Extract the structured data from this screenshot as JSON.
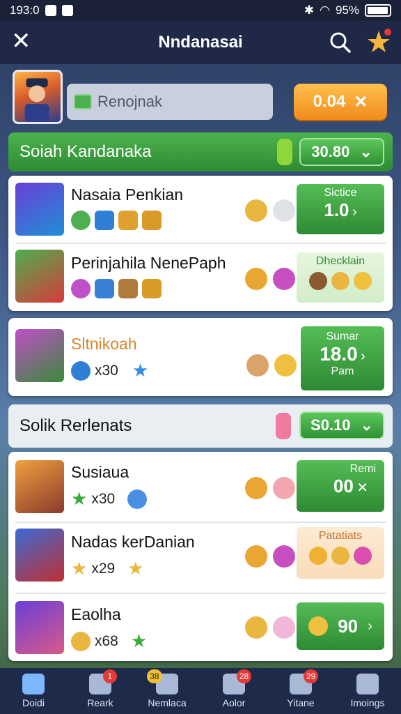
{
  "status": {
    "time": "193:0",
    "battery": "95%",
    "battery_level": 0.95
  },
  "header": {
    "title": "Nndanasai"
  },
  "profile": {
    "name": "Renojnak",
    "coins": "0.04"
  },
  "section1": {
    "title": "Soiah Kandanaka",
    "value": "30.80"
  },
  "group1": [
    {
      "name": "Nasaia Penkian",
      "action": {
        "label": "Sictice",
        "value": "1.0"
      }
    },
    {
      "name": "Perinjahila NenePaph",
      "action": {
        "label": "Dhecklain"
      }
    }
  ],
  "single": {
    "name": "Sltnikoah",
    "count": "x30",
    "action": {
      "label": "Sumar",
      "value": "18.0",
      "sub": "Pam"
    }
  },
  "section2": {
    "title": "Solik Rerlenats",
    "value": "S0.10"
  },
  "group2": [
    {
      "name": "Susiaua",
      "count": "x30",
      "action": {
        "label": "Remi",
        "value": "00"
      }
    },
    {
      "name": "Nadas kerDanian",
      "count": "x29",
      "action": {
        "label": "Patatiats"
      }
    },
    {
      "name": "Eaolha",
      "count": "x68",
      "action": {
        "value": "90"
      }
    }
  ],
  "nav": [
    {
      "label": "Doidi"
    },
    {
      "label": "Reark",
      "badge": "1"
    },
    {
      "label": "Nemlaca",
      "badge": "38"
    },
    {
      "label": "Aolor",
      "badge": "28"
    },
    {
      "label": "Yitane",
      "badge": "29"
    },
    {
      "label": "Imoings"
    }
  ],
  "colors": {
    "green": "#2e8a34",
    "orange": "#f08a1c",
    "nav": "#1e2a4a",
    "badge": "#e53935"
  }
}
